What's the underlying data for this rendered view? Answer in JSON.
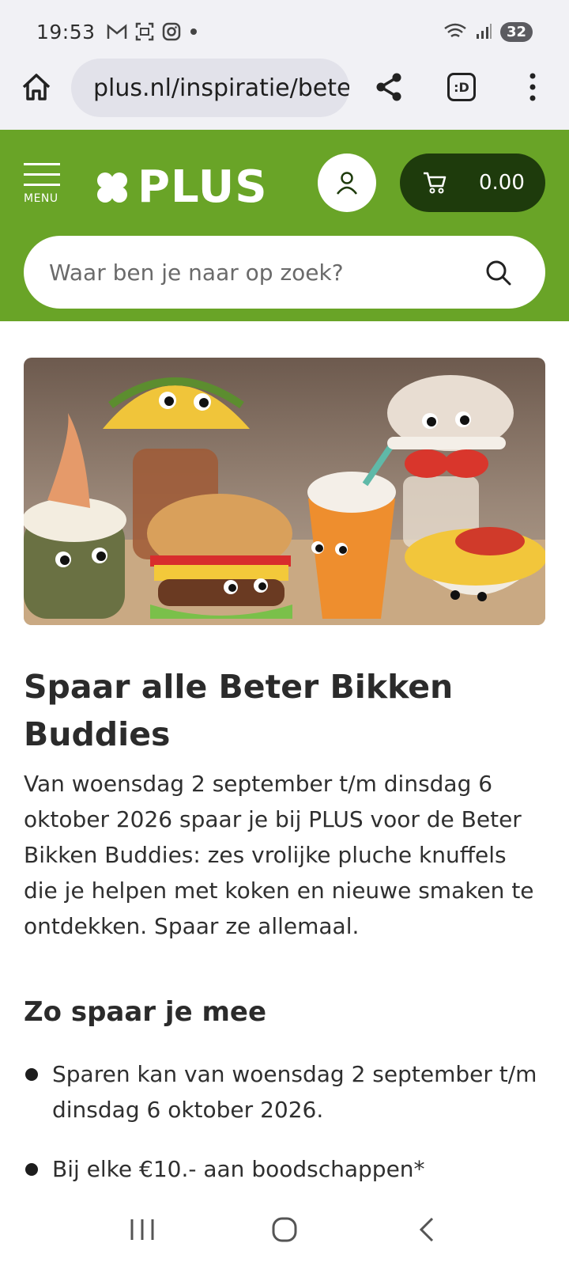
{
  "status_bar": {
    "time": "19:53",
    "battery": "32",
    "left_icons": [
      "gmail-icon",
      "screenshot-icon",
      "instagram-icon",
      "dot-icon"
    ],
    "right_icons": [
      "wifi-icon",
      "signal-icon",
      "battery-icon"
    ]
  },
  "browser": {
    "url": "plus.nl/inspiratie/beter-bikken-buddies",
    "tab_label": ":D"
  },
  "header": {
    "menu_label": "MENU",
    "logo_text": "PLUS",
    "cart_total": "0.00",
    "search_placeholder": "Waar ben je naar op zoek?",
    "brand_color": "#69a427",
    "cart_color": "#1e3b0c"
  },
  "article": {
    "title": "Spaar alle Beter Bikken Buddies",
    "intro": "Van woensdag 2 september t/m dinsdag 6 oktober 2026 spaar je bij PLUS voor de Beter Bikken Buddies: zes vrolijke pluche knuffels die je helpen met koken en nieuwe smaken te ontdekken. Spaar ze allemaal.",
    "section_title": "Zo spaar je mee",
    "bullets": [
      "Sparen kan van woensdag 2 september t/m dinsdag 6 oktober 2026.",
      "Bij elke €10.- aan boodschappen*"
    ]
  }
}
